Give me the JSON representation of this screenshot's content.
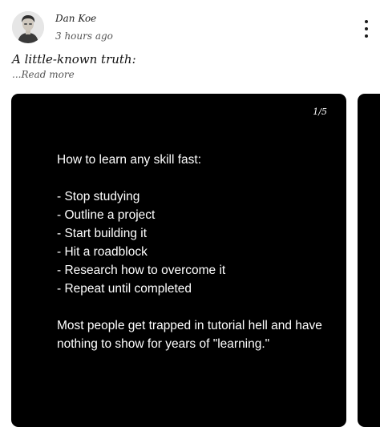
{
  "post": {
    "author": "Dan Koe",
    "timestamp": "3 hours ago",
    "headline": "A little-known truth:",
    "read_more": "...Read more",
    "more_icon": "vertical-ellipsis-icon"
  },
  "carousel": {
    "counter": "1/5",
    "slide": {
      "title": "How to learn any skill fast:",
      "steps": [
        "- Stop studying",
        "- Outline a project",
        "- Start building it",
        "- Hit a roadblock",
        "- Research how to overcome it",
        "- Repeat until completed"
      ],
      "conclusion": "Most people get trapped in tutorial hell and have nothing to show for years of \"learning.\""
    }
  },
  "colors": {
    "slide_background": "#000000",
    "slide_text": "#ffffff",
    "page_background": "#ffffff"
  }
}
